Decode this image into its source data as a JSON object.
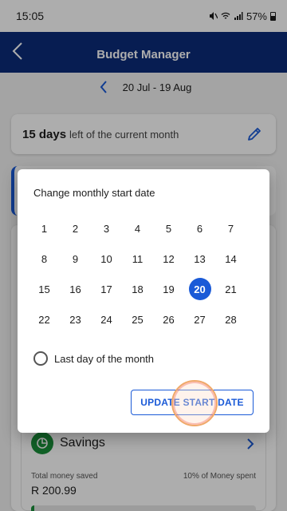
{
  "status_bar": {
    "time": "15:05",
    "battery": "57%",
    "icons": [
      "mute-icon",
      "wifi-icon",
      "signal-icon",
      "battery-icon"
    ]
  },
  "header": {
    "title": "Budget Manager",
    "back_icon": "back-arrow-icon"
  },
  "period": {
    "label": "20 Jul - 19 Aug",
    "prev_icon": "chevron-left-icon"
  },
  "days_card": {
    "count": "15 days",
    "suffix": "left of the current month",
    "edit_icon": "pencil-icon"
  },
  "savings": {
    "title": "Savings",
    "saved_label": "Total money saved",
    "saved_value": "R 200.99",
    "spent_label": "10% of Money spent",
    "progress": 0.1
  },
  "dialog": {
    "title": "Change monthly start date",
    "days": [
      "1",
      "2",
      "3",
      "4",
      "5",
      "6",
      "7",
      "8",
      "9",
      "10",
      "11",
      "12",
      "13",
      "14",
      "15",
      "16",
      "17",
      "18",
      "19",
      "20",
      "21",
      "22",
      "23",
      "24",
      "25",
      "26",
      "27",
      "28"
    ],
    "selected_day": "20",
    "last_day_label": "Last day of the month",
    "update_label": "UPDATE START DATE"
  },
  "colors": {
    "primary": "#1a5ad7",
    "header_bg": "#0b2b7a",
    "savings_green": "#1a8f3a"
  }
}
